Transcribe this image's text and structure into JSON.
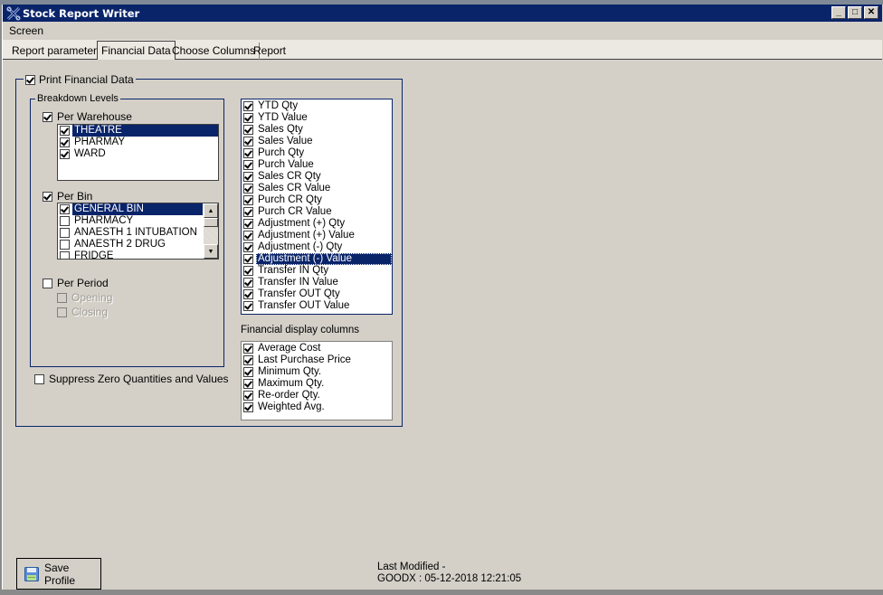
{
  "window": {
    "title": "Stock Report Writer",
    "icon": "app-x-icon",
    "controls": [
      "minimize",
      "maximize",
      "close"
    ],
    "control_glyphs": {
      "minimize": "_",
      "maximize": "□",
      "close": "✕"
    }
  },
  "menu": [
    {
      "label": "Screen"
    }
  ],
  "tabs": [
    {
      "label": "Report parameters",
      "active": false
    },
    {
      "label": "Financial Data",
      "active": true
    },
    {
      "label": "Choose Columns",
      "active": false
    },
    {
      "label": "Report",
      "active": false
    }
  ],
  "financial": {
    "print_financial_data": {
      "label": "Print Financial Data",
      "checked": true
    },
    "breakdown": {
      "title": "Breakdown Levels",
      "per_warehouse": {
        "label": "Per Warehouse",
        "checked": true,
        "items": [
          {
            "label": "THEATRE",
            "checked": true,
            "selected": true
          },
          {
            "label": "PHARMAY",
            "checked": true,
            "selected": false
          },
          {
            "label": "WARD",
            "checked": true,
            "selected": false
          }
        ]
      },
      "per_bin": {
        "label": "Per Bin",
        "checked": true,
        "items": [
          {
            "label": "GENERAL BIN",
            "checked": true,
            "selected": true
          },
          {
            "label": "PHARMACY",
            "checked": false,
            "selected": false
          },
          {
            "label": "ANAESTH 1 INTUBATION",
            "checked": false,
            "selected": false
          },
          {
            "label": "ANAESTH 2 DRUG",
            "checked": false,
            "selected": false
          },
          {
            "label": "FRIDGE",
            "checked": false,
            "selected": false
          }
        ]
      },
      "per_period": {
        "label": "Per Period",
        "checked": false,
        "opening": {
          "label": "Opening",
          "checked": false,
          "disabled": true
        },
        "closing": {
          "label": "Closing",
          "checked": false,
          "disabled": true
        }
      }
    },
    "suppress_zero": {
      "label": "Suppress Zero Quantities and Values",
      "checked": false
    },
    "financial_items": [
      {
        "label": "YTD Qty",
        "checked": true
      },
      {
        "label": "YTD Value",
        "checked": true
      },
      {
        "label": "Sales Qty",
        "checked": true
      },
      {
        "label": "Sales Value",
        "checked": true
      },
      {
        "label": "Purch Qty",
        "checked": true
      },
      {
        "label": "Purch Value",
        "checked": true
      },
      {
        "label": "Sales CR Qty",
        "checked": true
      },
      {
        "label": "Sales CR Value",
        "checked": true
      },
      {
        "label": "Purch CR Qty",
        "checked": true
      },
      {
        "label": "Purch CR Value",
        "checked": true
      },
      {
        "label": "Adjustment (+) Qty",
        "checked": true
      },
      {
        "label": "Adjustment (+) Value",
        "checked": true
      },
      {
        "label": "Adjustment (-) Qty",
        "checked": true
      },
      {
        "label": "Adjustment (-) Value",
        "checked": true,
        "selected": true
      },
      {
        "label": "Transfer IN Qty",
        "checked": true
      },
      {
        "label": "Transfer IN Value",
        "checked": true
      },
      {
        "label": "Transfer OUT Qty",
        "checked": true
      },
      {
        "label": "Transfer OUT Value",
        "checked": true
      }
    ],
    "display_columns": {
      "title": "Financial display columns",
      "items": [
        {
          "label": "Average Cost",
          "checked": true
        },
        {
          "label": "Last Purchase Price",
          "checked": true
        },
        {
          "label": "Minimum Qty.",
          "checked": true
        },
        {
          "label": "Maximum Qty.",
          "checked": true
        },
        {
          "label": "Re-order Qty.",
          "checked": true
        },
        {
          "label": "Weighted Avg.",
          "checked": true
        }
      ]
    }
  },
  "footer": {
    "save_profile_label": "Save Profile",
    "save_icon": "floppy-disk-icon",
    "last_modified_label": "Last Modified -",
    "last_modified_value": "GOODX : 05-12-2018 12:21:05"
  },
  "colors": {
    "titlebar": "#0a246a",
    "window_bg": "#d4d0c8",
    "selection": "#0a246a",
    "group_border": "#0a246a"
  }
}
